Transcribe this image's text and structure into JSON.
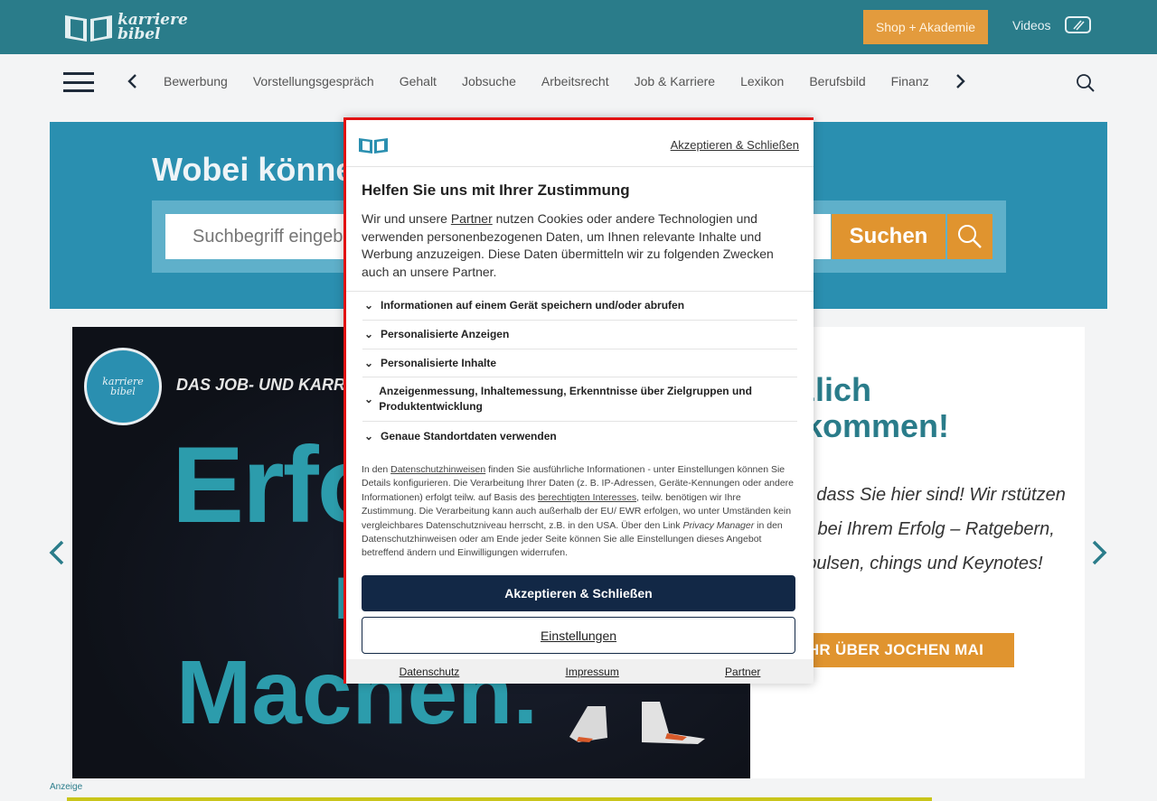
{
  "header": {
    "logo_text_line1": "karriere",
    "logo_text_line2": "bibel",
    "shop_label": "Shop + Akademie",
    "videos_label": "Videos"
  },
  "nav": {
    "items": [
      "Bewerbung",
      "Vorstellungsgespräch",
      "Gehalt",
      "Jobsuche",
      "Arbeitsrecht",
      "Job & Karriere",
      "Lexikon",
      "Berufsbild",
      "Finanz"
    ]
  },
  "hero": {
    "title": "Wobei könne",
    "search_placeholder": "Suchbegriff eingeb",
    "search_button": "Suchen"
  },
  "slide": {
    "logo_line1": "karriere",
    "logo_line2": "bibel",
    "tagline": "DAS JOB- UND KARR",
    "big1": "Erfo",
    "big2": "Ei",
    "big3": "Machen.",
    "heading_line1": "rzlich",
    "heading_line2": "llkommen!",
    "body": "ön, dass Sie hier sind! Wir rstützen Sie bei Ihrem Erfolg – Ratgebern, Impulsen, chings und Keynotes!",
    "cta": "HR ÜBER JOCHEN MAI"
  },
  "ad_label": "Anzeige",
  "consent": {
    "accept_link": "Akzeptieren & Schließen",
    "title": "Helfen Sie uns mit Ihrer Zustimmung",
    "intro_pre": "Wir und unsere ",
    "intro_link": "Partner",
    "intro_post": " nutzen Cookies oder andere Technologien und verwenden personenbezogenen Daten, um Ihnen relevante Inhalte und Werbung anzuzeigen. Diese Daten übermitteln wir zu folgenden Zwecken auch an unsere Partner.",
    "purposes": [
      "Informationen auf einem Gerät speichern und/oder abrufen",
      "Personalisierte Anzeigen",
      "Personalisierte Inhalte",
      "Anzeigenmessung, Inhaltemessung, Erkenntnisse über Zielgruppen und Produktentwicklung",
      "Genaue Standortdaten verwenden"
    ],
    "details_1": "In den ",
    "details_link1": "Datenschutzhinweisen",
    "details_2": " finden Sie ausführliche Informationen - unter Einstellungen können Sie Details konfigurieren. Die Verarbeitung Ihrer Daten (z. B. IP-Adressen, Geräte-Kennungen oder andere Informationen) erfolgt teilw. auf Basis des ",
    "details_link2": "berechtigten Interesses",
    "details_3": ", teilw. benötigen wir Ihre Zustimmung. Die Verarbeitung kann auch außerhalb der EU/ EWR erfolgen, wo unter Umständen kein vergleichbares Datenschutzniveau herrscht, z.B. in den USA. Über den Link ",
    "details_em": "Privacy Manager",
    "details_4": " in den Datenschutzhinweisen oder am Ende jeder Seite können Sie alle Einstellungen dieses Angebot betreffend ändern und Einwilligungen widerrufen.",
    "accept_button": "Akzeptieren & Schließen",
    "settings_button": "Einstellungen",
    "footer": {
      "privacy": "Datenschutz",
      "imprint": "Impressum",
      "partner": "Partner"
    }
  },
  "colors": {
    "brand_teal": "#2a7c8a",
    "hero_blue": "#2a8fb0",
    "accent_orange": "#e0942f",
    "consent_navy": "#122846",
    "consent_red": "#e21212"
  }
}
